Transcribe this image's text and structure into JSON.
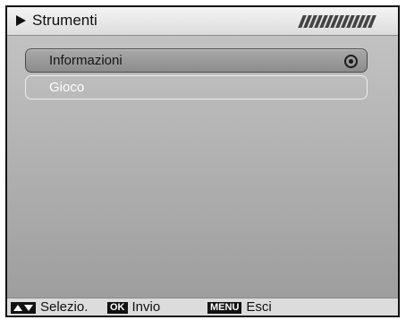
{
  "header": {
    "title": "Strumenti",
    "icon": "play-arrow-icon",
    "indicator_icon": "signal-stripes-icon"
  },
  "menu": {
    "items": [
      {
        "label": "Informazioni",
        "selected": true,
        "icon": "radio-selected-icon"
      },
      {
        "label": "Gioco",
        "selected": false
      }
    ]
  },
  "footer": {
    "hints": [
      {
        "key": "arrows-up-down",
        "label": "Selezio."
      },
      {
        "key": "OK",
        "label": "Invio"
      },
      {
        "key": "MENU",
        "label": "Esci"
      }
    ]
  },
  "colors": {
    "background": "#9a9a9a",
    "title_bar": "#e6e6e6",
    "selected_item": "#999999",
    "item_border": "#ededed",
    "text_dark": "#111111",
    "text_light": "#ffffff"
  }
}
